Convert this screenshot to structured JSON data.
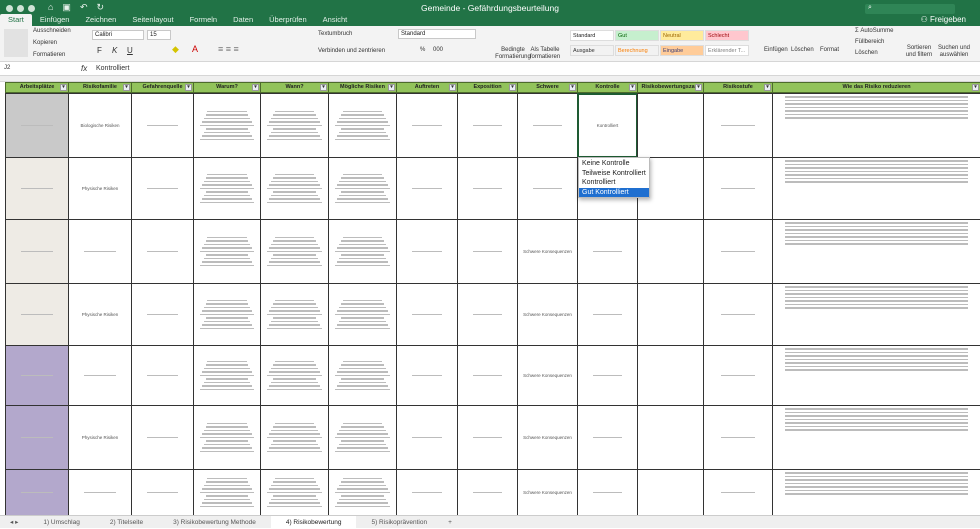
{
  "window": {
    "title": "Gemeinde - Gefährdungsbeurteilung",
    "share": "Freigeben",
    "search_icon": "search-icon"
  },
  "menu": [
    "Start",
    "Einfügen",
    "Zeichnen",
    "Seitenlayout",
    "Formeln",
    "Daten",
    "Überprüfen",
    "Ansicht"
  ],
  "ribbon": {
    "cut": "Ausschneiden",
    "copy": "Kopieren",
    "format_painter": "Formatieren",
    "font": "Calibri",
    "font_size": "15",
    "bold": "F",
    "italic": "K",
    "underline": "U",
    "wrap": "Textumbruch",
    "merge": "Verbinden und zentrieren",
    "number_format": "Standard",
    "percent": "%",
    "thousands": "000",
    "cond_format": "Bedingte Formatierung",
    "as_table": "Als Tabelle formatieren",
    "styles": [
      {
        "label": "Standard",
        "bg": "#ffffff",
        "color": "#222"
      },
      {
        "label": "Gut",
        "bg": "#c6efce",
        "color": "#006100"
      },
      {
        "label": "Neutral",
        "bg": "#ffeb9c",
        "color": "#9c6500"
      },
      {
        "label": "Schlecht",
        "bg": "#ffc7ce",
        "color": "#9c0006"
      },
      {
        "label": "Ausgabe",
        "bg": "#f2f2f2",
        "color": "#333"
      },
      {
        "label": "Berechnung",
        "bg": "#f2f2f2",
        "color": "#fa7d00"
      },
      {
        "label": "Eingabe",
        "bg": "#ffcc99",
        "color": "#3f3f76"
      },
      {
        "label": "Erklärender T...",
        "bg": "#ffffff",
        "color": "#7f7f7f"
      }
    ],
    "insert": "Einfügen",
    "delete": "Löschen",
    "format": "Format",
    "autosum": "AutoSumme",
    "fill": "Füllbereich",
    "clear": "Löschen",
    "sort": "Sortieren und filtern",
    "find": "Suchen und auswählen"
  },
  "formula_bar": {
    "cell_ref": "J2",
    "fx": "fx",
    "value": "Kontrolliert"
  },
  "headers": [
    "Arbeitsplätze",
    "Risikofamilie",
    "Gefahrenquelle",
    "Warum?",
    "Wann?",
    "Mögliche Risiken",
    "Auftreten",
    "Exposition",
    "Schwere",
    "Kontrolle",
    "Risikobewertungszahl",
    "Risikostufe",
    "Wie das Risiko reduzieren"
  ],
  "rows": [
    {
      "a_color": "#c9c9c9",
      "family": "Biologische Risiken",
      "control": "Kontrolliert"
    },
    {
      "a_color": "#eeebe5",
      "family": "Physische Risiken",
      "control": ""
    },
    {
      "a_color": "#eeebe5",
      "family": "",
      "control": "Schwere Konsequenzen"
    },
    {
      "a_color": "#eeebe5",
      "family": "Physische Risiken",
      "control": "Schwere Konsequenzen"
    },
    {
      "a_color": "#b3a8cc",
      "family": "",
      "control": "Schwere Konsequenzen"
    },
    {
      "a_color": "#b3a8cc",
      "family": "Physische Risiken",
      "control": "Schwere Konsequenzen"
    },
    {
      "a_color": "#b3a8cc",
      "family": "",
      "control": "Schwere Konsequenzen"
    }
  ],
  "dropdown": {
    "options": [
      "Keine Kontrolle",
      "Teilweise Kontrolliert",
      "Kontrolliert",
      "Gut Kontrolliert"
    ],
    "selected": "Gut Kontrolliert"
  },
  "sheets": [
    "1) Umschlag",
    "2) Titelseite",
    "3) Risikobewertung Methode",
    "4) Risikobewertung",
    "5) Risikoprävention"
  ],
  "active_sheet": "4) Risikobewertung",
  "accent": "#217346",
  "header_green": "#92c35b"
}
